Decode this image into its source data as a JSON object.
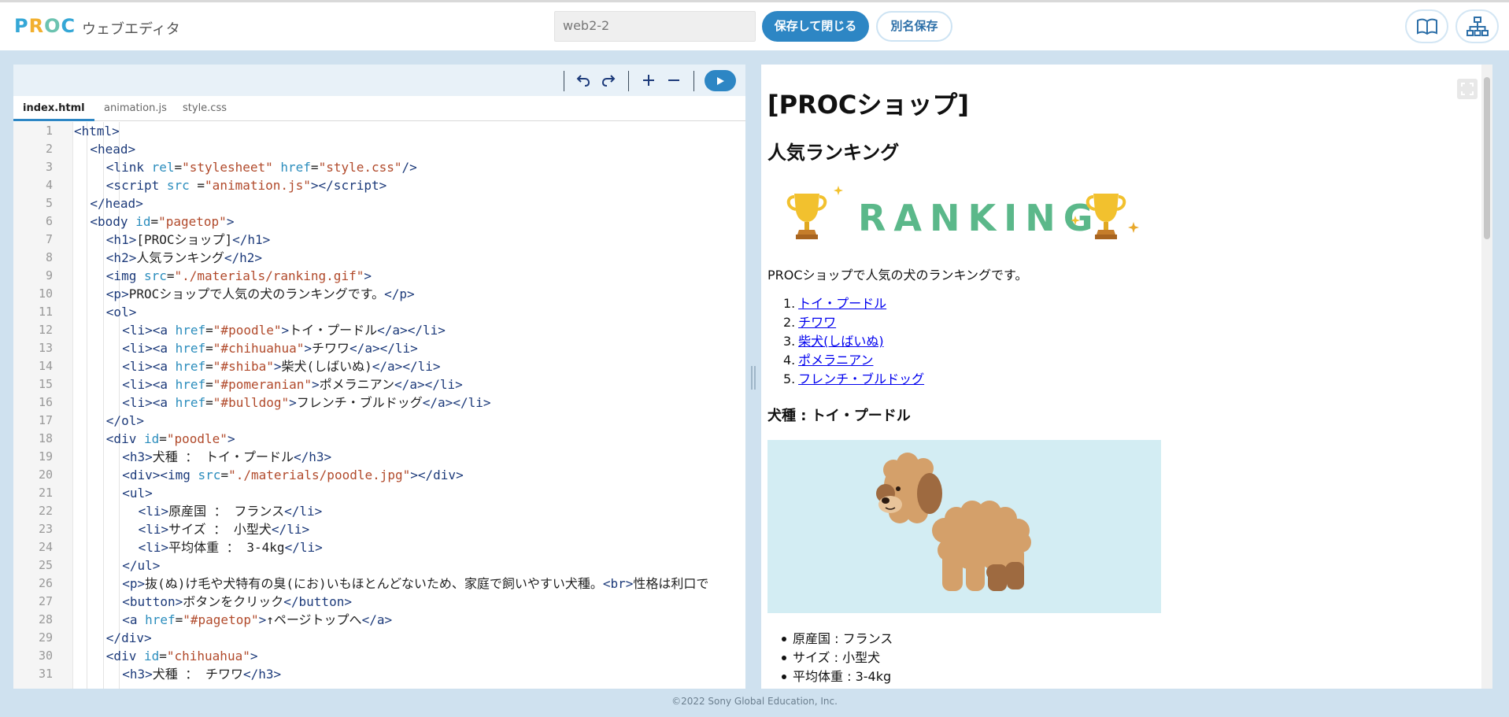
{
  "app": {
    "logo_text": "PROC",
    "title": "ウェブエディタ",
    "filename": "web2-2",
    "save_close_label": "保存して閉じる",
    "save_as_label": "別名保存"
  },
  "header_icons": [
    "book-icon",
    "sitemap-icon"
  ],
  "editor": {
    "toolbar_icons": [
      "undo-icon",
      "redo-icon",
      "zoom-in-icon",
      "zoom-out-icon",
      "run-icon"
    ],
    "tabs": [
      {
        "label": "index.html",
        "active": true
      },
      {
        "label": "animation.js",
        "active": false
      },
      {
        "label": "style.css",
        "active": false
      }
    ],
    "lines": [
      {
        "n": "1",
        "indent": 0,
        "html": "<span class='t'>&lt;html&gt;</span>"
      },
      {
        "n": "2",
        "indent": 1,
        "html": "<span class='t'>&lt;head&gt;</span>"
      },
      {
        "n": "3",
        "indent": 2,
        "html": "<span class='t'>&lt;link</span> <span class='a'>rel</span>=<span class='s'>\"stylesheet\"</span> <span class='a'>href</span>=<span class='s'>\"style.css\"</span><span class='t'>/&gt;</span>"
      },
      {
        "n": "4",
        "indent": 2,
        "html": "<span class='t'>&lt;script</span> <span class='a'>src</span> =<span class='s'>\"animation.js\"</span><span class='t'>&gt;&lt;/script&gt;</span>"
      },
      {
        "n": "5",
        "indent": 1,
        "html": "<span class='t'>&lt;/head&gt;</span>"
      },
      {
        "n": "6",
        "indent": 1,
        "html": "<span class='t'>&lt;body</span> <span class='a'>id</span>=<span class='s'>\"pagetop\"</span><span class='t'>&gt;</span>"
      },
      {
        "n": "7",
        "indent": 2,
        "html": "<span class='t'>&lt;h1&gt;</span>[PROCショップ]<span class='t'>&lt;/h1&gt;</span>"
      },
      {
        "n": "8",
        "indent": 2,
        "html": "<span class='t'>&lt;h2&gt;</span>人気ランキング<span class='t'>&lt;/h2&gt;</span>"
      },
      {
        "n": "9",
        "indent": 2,
        "html": "<span class='t'>&lt;img</span> <span class='a'>src</span>=<span class='s'>\"./materials/ranking.gif\"</span><span class='t'>&gt;</span>"
      },
      {
        "n": "10",
        "indent": 2,
        "html": "<span class='t'>&lt;p&gt;</span>PROCショップで人気の犬のランキングです。<span class='t'>&lt;/p&gt;</span>"
      },
      {
        "n": "11",
        "indent": 2,
        "html": "<span class='t'>&lt;ol&gt;</span>"
      },
      {
        "n": "12",
        "indent": 3,
        "html": "<span class='t'>&lt;li&gt;&lt;a</span> <span class='a'>href</span>=<span class='s'>\"#poodle\"</span><span class='t'>&gt;</span>トイ・プードル<span class='t'>&lt;/a&gt;&lt;/li&gt;</span>"
      },
      {
        "n": "13",
        "indent": 3,
        "html": "<span class='t'>&lt;li&gt;&lt;a</span> <span class='a'>href</span>=<span class='s'>\"#chihuahua\"</span><span class='t'>&gt;</span>チワワ<span class='t'>&lt;/a&gt;&lt;/li&gt;</span>"
      },
      {
        "n": "14",
        "indent": 3,
        "html": "<span class='t'>&lt;li&gt;&lt;a</span> <span class='a'>href</span>=<span class='s'>\"#shiba\"</span><span class='t'>&gt;</span>柴犬(しばいぬ)<span class='t'>&lt;/a&gt;&lt;/li&gt;</span>"
      },
      {
        "n": "15",
        "indent": 3,
        "html": "<span class='t'>&lt;li&gt;&lt;a</span> <span class='a'>href</span>=<span class='s'>\"#pomeranian\"</span><span class='t'>&gt;</span>ポメラニアン<span class='t'>&lt;/a&gt;&lt;/li&gt;</span>"
      },
      {
        "n": "16",
        "indent": 3,
        "html": "<span class='t'>&lt;li&gt;&lt;a</span> <span class='a'>href</span>=<span class='s'>\"#bulldog\"</span><span class='t'>&gt;</span>フレンチ・ブルドッグ<span class='t'>&lt;/a&gt;&lt;/li&gt;</span>"
      },
      {
        "n": "17",
        "indent": 2,
        "html": "<span class='t'>&lt;/ol&gt;</span>"
      },
      {
        "n": "18",
        "indent": 2,
        "html": "<span class='t'>&lt;div</span> <span class='a'>id</span>=<span class='s'>\"poodle\"</span><span class='t'>&gt;</span>"
      },
      {
        "n": "19",
        "indent": 3,
        "html": "<span class='t'>&lt;h3&gt;</span>犬種 ： トイ・プードル<span class='t'>&lt;/h3&gt;</span>"
      },
      {
        "n": "20",
        "indent": 3,
        "html": "<span class='t'>&lt;div&gt;&lt;img</span> <span class='a'>src</span>=<span class='s'>\"./materials/poodle.jpg\"</span><span class='t'>&gt;&lt;/div&gt;</span>"
      },
      {
        "n": "21",
        "indent": 3,
        "html": "<span class='t'>&lt;ul&gt;</span>"
      },
      {
        "n": "22",
        "indent": 4,
        "html": "<span class='t'>&lt;li&gt;</span>原産国 ： フランス<span class='t'>&lt;/li&gt;</span>"
      },
      {
        "n": "23",
        "indent": 4,
        "html": "<span class='t'>&lt;li&gt;</span>サイズ ： 小型犬<span class='t'>&lt;/li&gt;</span>"
      },
      {
        "n": "24",
        "indent": 4,
        "html": "<span class='t'>&lt;li&gt;</span>平均体重 ： 3-4kg<span class='t'>&lt;/li&gt;</span>"
      },
      {
        "n": "25",
        "indent": 3,
        "html": "<span class='t'>&lt;/ul&gt;</span>"
      },
      {
        "n": "26",
        "indent": 3,
        "html": "<span class='t'>&lt;p&gt;</span>抜(ぬ)け毛や犬特有の臭(にお)いもほとんどないため、家庭で飼いやすい犬種。<span class='t'>&lt;br&gt;</span>性格は利口で"
      },
      {
        "n": "27",
        "indent": 3,
        "html": "<span class='t'>&lt;button&gt;</span>ボタンをクリック<span class='t'>&lt;/button&gt;</span>"
      },
      {
        "n": "28",
        "indent": 3,
        "html": "<span class='t'>&lt;a</span> <span class='a'>href</span>=<span class='s'>\"#pagetop\"</span><span class='t'>&gt;</span>↑ページトップへ<span class='t'>&lt;/a&gt;</span>"
      },
      {
        "n": "29",
        "indent": 2,
        "html": "<span class='t'>&lt;/div&gt;</span>"
      },
      {
        "n": "30",
        "indent": 2,
        "html": "<span class='t'>&lt;div</span> <span class='a'>id</span>=<span class='s'>\"chihuahua\"</span><span class='t'>&gt;</span>"
      },
      {
        "n": "31",
        "indent": 3,
        "html": "<span class='t'>&lt;h3&gt;</span>犬種 ： チワワ<span class='t'>&lt;/h3&gt;</span>"
      }
    ]
  },
  "preview": {
    "h1": "[PROCショップ]",
    "h2": "人気ランキング",
    "ranking_text": "RANKING",
    "paragraph": "PROCショップで人気の犬のランキングです。",
    "ranking_list": [
      {
        "num": "1.",
        "label": "トイ・プードル"
      },
      {
        "num": "2.",
        "label": "チワワ"
      },
      {
        "num": "3.",
        "label": "柴犬(しばいぬ)"
      },
      {
        "num": "4.",
        "label": "ポメラニアン"
      },
      {
        "num": "5.",
        "label": "フレンチ・ブルドッグ"
      }
    ],
    "h3": "犬種 : トイ・プードル",
    "details": [
      "原産国 : フランス",
      "サイズ : 小型犬",
      "平均体重 : 3-4kg"
    ],
    "dog_image_bg": "#d3edf3"
  },
  "footer": {
    "copyright": "©2022 Sony Global Education, Inc."
  },
  "colors": {
    "accent": "#2d86c4",
    "ranking_green": "#5bb88a",
    "trophy_gold": "#f2c12e"
  }
}
